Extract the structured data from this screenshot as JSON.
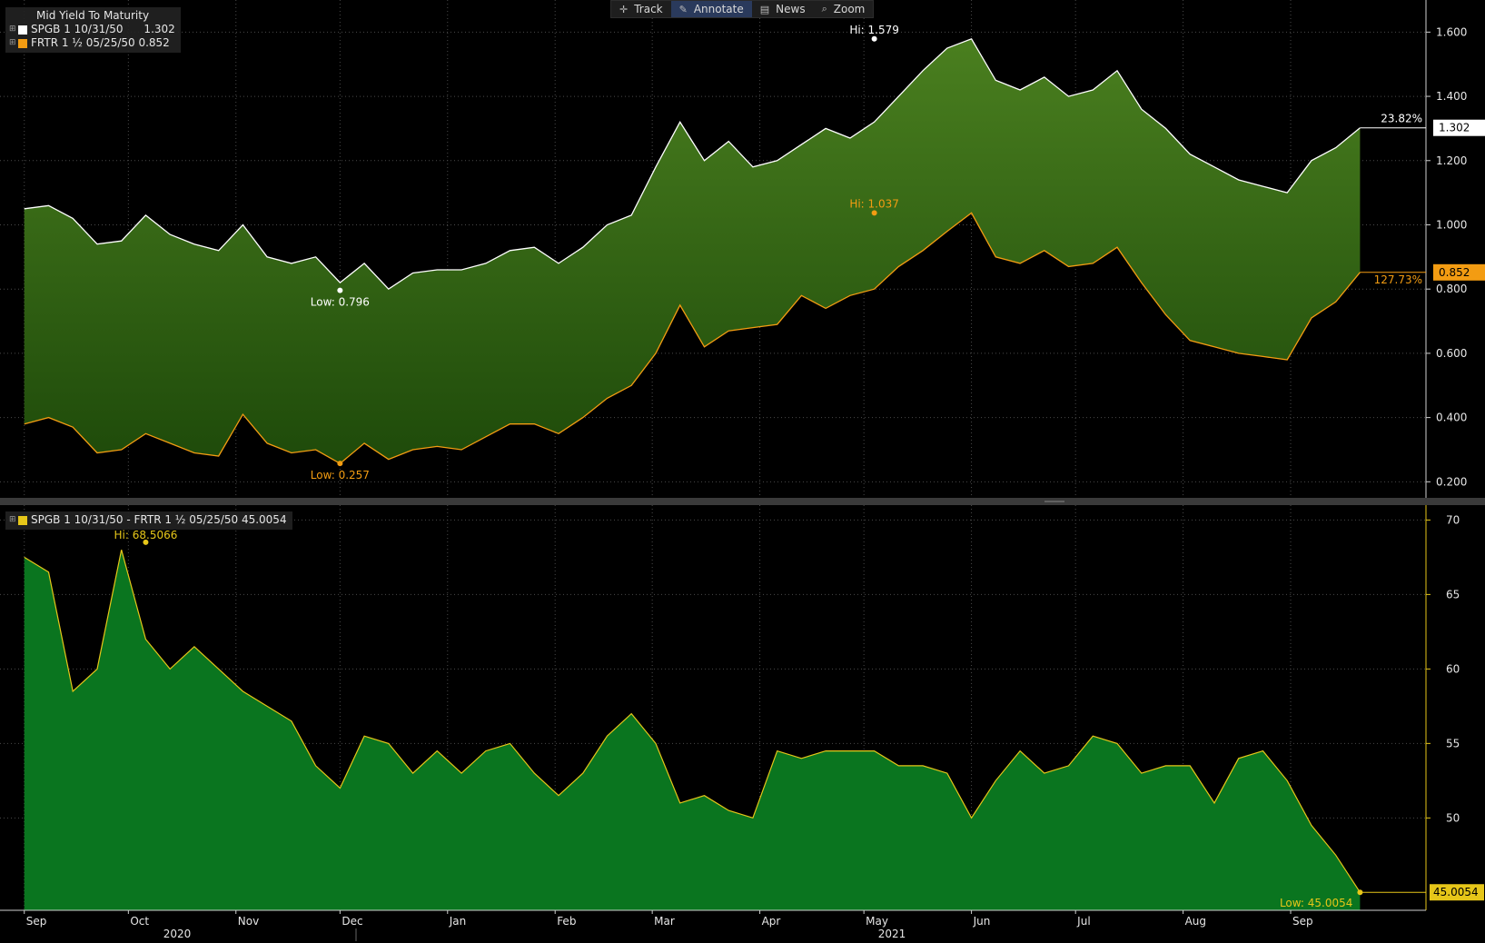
{
  "toolbar": {
    "buttons": [
      {
        "label": "Track",
        "icon": "crosshair-icon"
      },
      {
        "label": "Annotate",
        "icon": "pencil-icon"
      },
      {
        "label": "News",
        "icon": "news-icon"
      },
      {
        "label": "Zoom",
        "icon": "magnifier-icon"
      }
    ]
  },
  "legend_top": {
    "title": "Mid Yield To Maturity",
    "rows": [
      {
        "text": "SPGB 1 10/31/50      1.302",
        "color": "#ffffff"
      },
      {
        "text": "FRTR 1 ½ 05/25/50 0.852",
        "color": "#f39c12"
      }
    ]
  },
  "legend_bottom": {
    "rows": [
      {
        "text": "SPGB 1 10/31/50 - FRTR 1 ½ 05/25/50 45.0054",
        "color": "#e6c619"
      }
    ]
  },
  "colors": {
    "spgb_line": "#ffffff",
    "frtr_line": "#f39c12",
    "spread_line": "#e6c619",
    "band_fill_top": "#4a7f1f",
    "band_fill_bottom": "#1e4a0a",
    "spread_fill": "#0a751f",
    "grid": "#4a4a4a",
    "badge_white": "#ffffff",
    "badge_orange": "#f39c12",
    "badge_yellow": "#e6c619"
  },
  "chart_data": [
    {
      "type": "area",
      "title": "Mid Yield To Maturity",
      "x": [
        "2020-09-01",
        "2020-09-08",
        "2020-09-15",
        "2020-09-22",
        "2020-09-29",
        "2020-10-06",
        "2020-10-13",
        "2020-10-20",
        "2020-10-27",
        "2020-11-03",
        "2020-11-10",
        "2020-11-17",
        "2020-11-24",
        "2020-12-01",
        "2020-12-08",
        "2020-12-15",
        "2020-12-22",
        "2020-12-29",
        "2021-01-05",
        "2021-01-12",
        "2021-01-19",
        "2021-01-26",
        "2021-02-02",
        "2021-02-09",
        "2021-02-16",
        "2021-02-23",
        "2021-03-02",
        "2021-03-09",
        "2021-03-16",
        "2021-03-23",
        "2021-03-30",
        "2021-04-06",
        "2021-04-13",
        "2021-04-20",
        "2021-04-27",
        "2021-05-04",
        "2021-05-11",
        "2021-05-18",
        "2021-05-25",
        "2021-06-01",
        "2021-06-08",
        "2021-06-15",
        "2021-06-22",
        "2021-06-29",
        "2021-07-06",
        "2021-07-13",
        "2021-07-20",
        "2021-07-27",
        "2021-08-03",
        "2021-08-10",
        "2021-08-17",
        "2021-08-24",
        "2021-08-31",
        "2021-09-07",
        "2021-09-14",
        "2021-09-21"
      ],
      "series": [
        {
          "name": "SPGB 1 10/31/50",
          "values": [
            1.05,
            1.06,
            1.02,
            0.94,
            0.95,
            1.03,
            0.97,
            0.94,
            0.92,
            1.0,
            0.9,
            0.88,
            0.9,
            0.82,
            0.88,
            0.8,
            0.85,
            0.86,
            0.86,
            0.88,
            0.92,
            0.93,
            0.88,
            0.93,
            1.0,
            1.03,
            1.18,
            1.32,
            1.2,
            1.26,
            1.18,
            1.2,
            1.25,
            1.3,
            1.27,
            1.32,
            1.4,
            1.48,
            1.55,
            1.579,
            1.45,
            1.42,
            1.46,
            1.4,
            1.42,
            1.48,
            1.36,
            1.3,
            1.22,
            1.18,
            1.14,
            1.12,
            1.1,
            1.2,
            1.24,
            1.302
          ]
        },
        {
          "name": "FRTR 1 ½ 05/25/50",
          "values": [
            0.38,
            0.4,
            0.37,
            0.29,
            0.3,
            0.35,
            0.32,
            0.29,
            0.28,
            0.41,
            0.32,
            0.29,
            0.3,
            0.257,
            0.32,
            0.27,
            0.3,
            0.31,
            0.3,
            0.34,
            0.38,
            0.38,
            0.35,
            0.4,
            0.46,
            0.5,
            0.6,
            0.75,
            0.62,
            0.67,
            0.68,
            0.69,
            0.78,
            0.74,
            0.78,
            0.8,
            0.87,
            0.92,
            0.98,
            1.037,
            0.9,
            0.88,
            0.92,
            0.87,
            0.88,
            0.93,
            0.82,
            0.72,
            0.64,
            0.62,
            0.6,
            0.59,
            0.58,
            0.71,
            0.76,
            0.852
          ]
        }
      ],
      "annotations": [
        {
          "label": "Hi: 1.579",
          "series": "SPGB 1 10/31/50",
          "x": "2021-05-04",
          "y": 1.579
        },
        {
          "label": "Low: 0.796",
          "series": "SPGB 1 10/31/50",
          "x": "2020-12-01",
          "y": 0.796
        },
        {
          "label": "Hi: 1.037",
          "series": "FRTR 1 ½ 05/25/50",
          "x": "2021-05-04",
          "y": 1.037
        },
        {
          "label": "Low: 0.257",
          "series": "FRTR 1 ½ 05/25/50",
          "x": "2020-12-01",
          "y": 0.257
        }
      ],
      "badges": [
        {
          "value": "1.302",
          "pct": "23.82%",
          "y": 1.302
        },
        {
          "value": "0.852",
          "pct": "127.73%",
          "y": 0.852
        }
      ],
      "ylim": [
        0.15,
        1.7
      ],
      "yticks": [
        "1.600",
        "1.400",
        "1.200",
        "1.000",
        "0.800",
        "0.600",
        "0.400",
        "0.200"
      ],
      "grid": true
    },
    {
      "type": "area",
      "x": [
        "2020-09-01",
        "2020-09-08",
        "2020-09-15",
        "2020-09-22",
        "2020-09-29",
        "2020-10-06",
        "2020-10-13",
        "2020-10-20",
        "2020-10-27",
        "2020-11-03",
        "2020-11-10",
        "2020-11-17",
        "2020-11-24",
        "2020-12-01",
        "2020-12-08",
        "2020-12-15",
        "2020-12-22",
        "2020-12-29",
        "2021-01-05",
        "2021-01-12",
        "2021-01-19",
        "2021-01-26",
        "2021-02-02",
        "2021-02-09",
        "2021-02-16",
        "2021-02-23",
        "2021-03-02",
        "2021-03-09",
        "2021-03-16",
        "2021-03-23",
        "2021-03-30",
        "2021-04-06",
        "2021-04-13",
        "2021-04-20",
        "2021-04-27",
        "2021-05-04",
        "2021-05-11",
        "2021-05-18",
        "2021-05-25",
        "2021-06-01",
        "2021-06-08",
        "2021-06-15",
        "2021-06-22",
        "2021-06-29",
        "2021-07-06",
        "2021-07-13",
        "2021-07-20",
        "2021-07-27",
        "2021-08-03",
        "2021-08-10",
        "2021-08-17",
        "2021-08-24",
        "2021-08-31",
        "2021-09-07",
        "2021-09-14",
        "2021-09-21"
      ],
      "series": [
        {
          "name": "SPGB 1 10/31/50 - FRTR 1 ½ 05/25/50",
          "values": [
            67.5,
            66.5,
            58.5,
            60.0,
            68.0,
            62.0,
            60.0,
            61.5,
            60.0,
            58.5,
            57.5,
            56.5,
            53.5,
            52.0,
            55.5,
            55.0,
            53.0,
            54.5,
            53.0,
            54.5,
            55.0,
            53.0,
            51.5,
            53.0,
            55.5,
            57.0,
            55.0,
            51.0,
            51.5,
            50.5,
            50.0,
            54.5,
            54.0,
            54.5,
            54.5,
            54.5,
            53.5,
            53.5,
            53.0,
            50.0,
            52.5,
            54.5,
            53.0,
            53.5,
            55.5,
            55.0,
            53.0,
            53.5,
            53.5,
            51.0,
            54.0,
            54.5,
            52.5,
            49.5,
            47.5,
            45.0054
          ]
        }
      ],
      "annotations": [
        {
          "label": "Hi: 68.5066",
          "x": "2020-10-06",
          "y": 68.5066
        },
        {
          "label": "Low: 45.0054",
          "x": "2021-09-21",
          "y": 45.0054
        }
      ],
      "badges": [
        {
          "value": "45.0054",
          "y": 45.0054
        }
      ],
      "ylim": [
        43.8,
        71
      ],
      "yticks": [
        "70",
        "65",
        "60",
        "55",
        "50"
      ],
      "grid": true
    }
  ],
  "x_axis": {
    "month_labels": [
      {
        "label": "Sep",
        "date": "2020-09-01"
      },
      {
        "label": "Oct",
        "date": "2020-10-01"
      },
      {
        "label": "Nov",
        "date": "2020-11-01"
      },
      {
        "label": "Dec",
        "date": "2020-12-01"
      },
      {
        "label": "Jan",
        "date": "2021-01-01"
      },
      {
        "label": "Feb",
        "date": "2021-02-01"
      },
      {
        "label": "Mar",
        "date": "2021-03-01"
      },
      {
        "label": "Apr",
        "date": "2021-04-01"
      },
      {
        "label": "May",
        "date": "2021-05-01"
      },
      {
        "label": "Jun",
        "date": "2021-06-01"
      },
      {
        "label": "Jul",
        "date": "2021-07-01"
      },
      {
        "label": "Aug",
        "date": "2021-08-01"
      },
      {
        "label": "Sep",
        "date": "2021-09-01"
      }
    ],
    "year_labels": [
      "2020",
      "2021"
    ]
  }
}
